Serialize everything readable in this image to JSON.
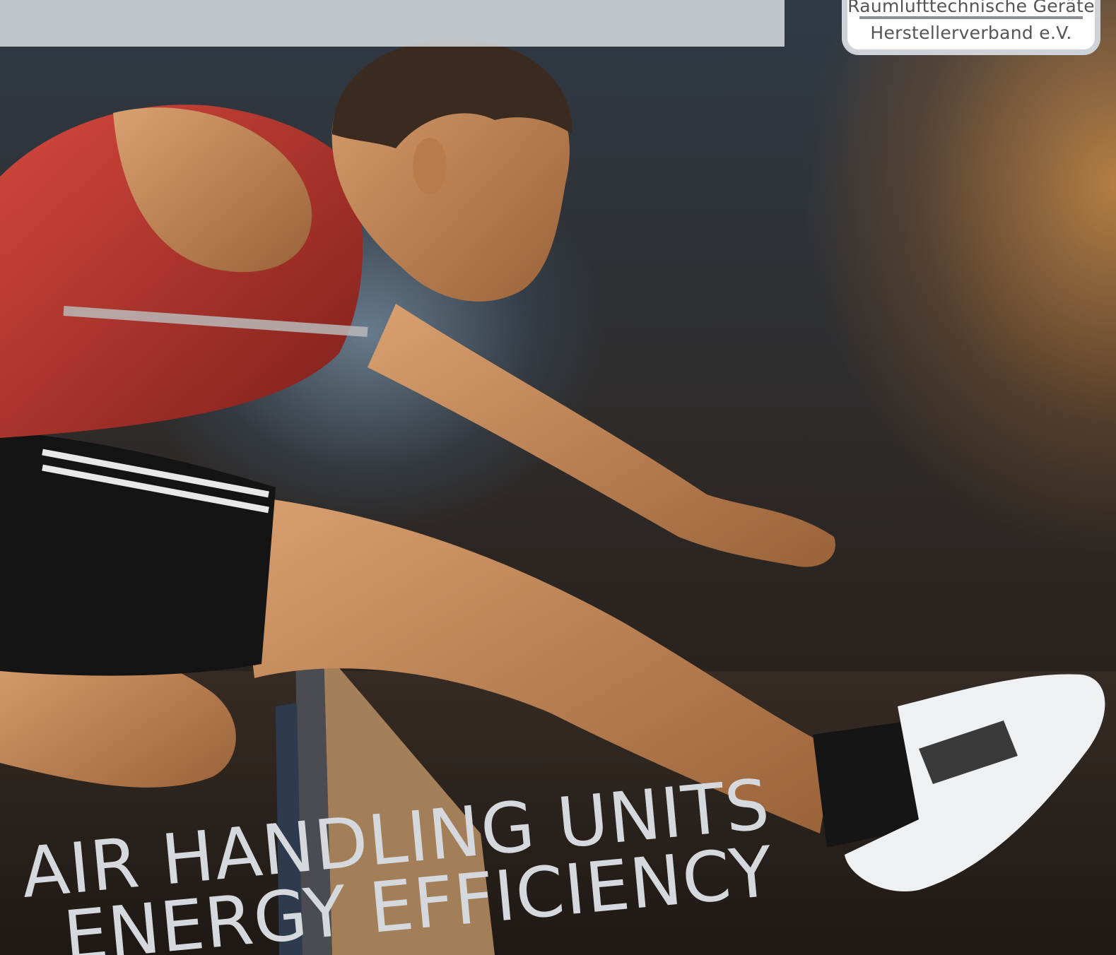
{
  "logo": {
    "line1": "Raumlufttechnische Geräte",
    "line2": "Herstellerverband e.V."
  },
  "headline": {
    "line1": "AIR HANDLING UNITS",
    "line2": "ENERGY EFFICIENCY"
  },
  "colors": {
    "header_band": "#e1e4e8",
    "badge_border": "#cfd2d6",
    "headline_text": "#d5d8dc",
    "singlet_red": "#b8322a",
    "skin": "#c88a5a",
    "warm_light": "#e19646",
    "cool_light": "#96b9d7"
  },
  "icons": {
    "photo": "hurdler-athlete-photo"
  }
}
